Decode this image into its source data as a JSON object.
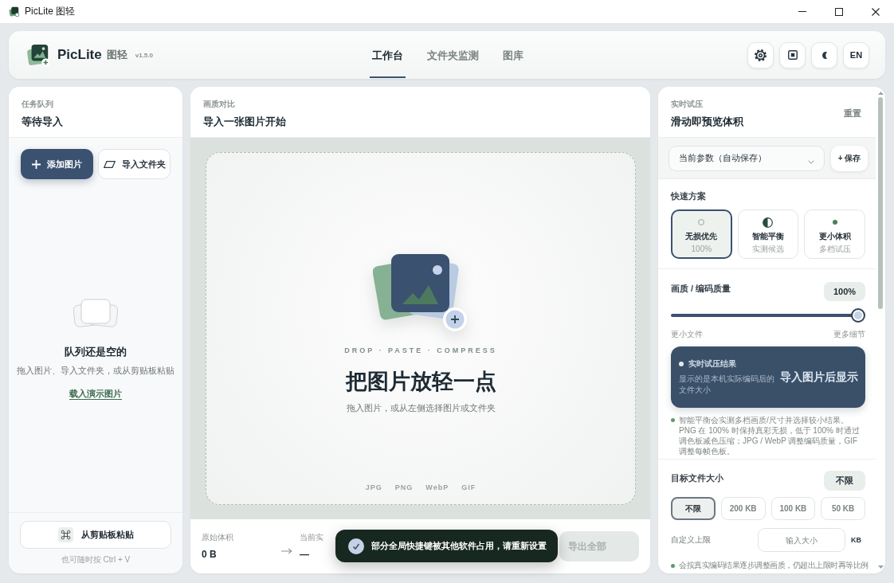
{
  "window": {
    "title": "PicLite 图轻"
  },
  "header": {
    "app_name": "PicLite",
    "app_subtitle": "图轻",
    "version": "v1.5.0",
    "tabs": [
      {
        "label": "工作台",
        "selected": true
      },
      {
        "label": "文件夹监测",
        "selected": false
      },
      {
        "label": "图库",
        "selected": false
      }
    ],
    "language_button": "EN"
  },
  "queue": {
    "caption": "任务队列",
    "title": "等待导入",
    "add_button": "添加图片",
    "folder_button": "导入文件夹",
    "empty_title": "队列还是空的",
    "empty_text": "拖入图片、导入文件夹，或从剪贴板粘贴",
    "demo_link": "载入演示图片",
    "paste_button": "从剪贴板粘贴",
    "hint": "也可随时按 Ctrl + V"
  },
  "compare": {
    "caption": "画质对比",
    "title": "导入一张图片开始",
    "tagline": "DROP · PASTE · COMPRESS",
    "drop_title": "把图片放轻一点",
    "drop_text": "拖入图片，或从左侧选择图片或文件夹",
    "formats": [
      "JPG",
      "PNG",
      "WebP",
      "GIF"
    ],
    "stats": [
      {
        "label": "原始体积",
        "value": "0 B"
      },
      {
        "label": "当前实",
        "value": "—"
      }
    ],
    "export_button": {
      "label": "导出全部",
      "disabled": true
    }
  },
  "tuning": {
    "caption": "实时试压",
    "title": "滑动即预览体积",
    "reset_button": "重置",
    "preset": "当前参数（自动保存）",
    "save_button": "+ 保存",
    "quick_title": "快速方案",
    "quick_options": [
      {
        "kind": "lossless",
        "label": "无损优先",
        "sub": "100%",
        "selected": true
      },
      {
        "kind": "balanced",
        "label": "智能平衡",
        "sub": "实测候选",
        "selected": false
      },
      {
        "kind": "smaller",
        "label": "更小体积",
        "sub": "多档试压",
        "selected": false
      }
    ],
    "quality": {
      "title": "画质 / 编码质量",
      "value": "100%",
      "level": 1,
      "min_label": "更小文件",
      "max_label": "更多细节"
    },
    "result": {
      "title": "实时试压结果",
      "text": "显示的是本机实际编码后的文件大小",
      "value": "导入图片后显示"
    },
    "quality_note": "智能平衡会实测多档画质/尺寸并选择较小结果。PNG 在 100% 时保持真彩无损，低于 100% 时通过调色板减色压缩；JPG / WebP 调整编码质量，GIF 调整每帧色板。",
    "target": {
      "title": "目标文件大小",
      "value": "不限",
      "options": [
        {
          "label": "不限",
          "selected": true
        },
        {
          "label": "200 KB",
          "selected": false
        },
        {
          "label": "100 KB",
          "selected": false
        },
        {
          "label": "50 KB",
          "selected": false
        }
      ],
      "custom_label": "自定义上限",
      "placeholder": "输入大小",
      "unit": "KB",
      "note": "会按真实编码结果逐步调整画质，仍超出上限时再等比例"
    }
  },
  "toast": {
    "message": "部分全局快捷键被其他软件占用，请重新设置"
  }
}
